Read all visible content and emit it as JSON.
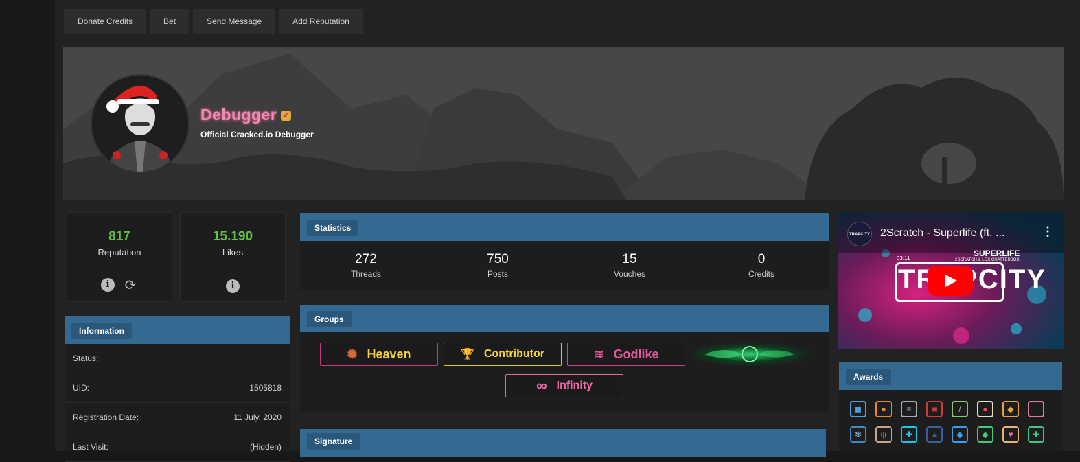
{
  "actions": [
    "Donate Credits",
    "Bet",
    "Send Message",
    "Add Reputation"
  ],
  "profile": {
    "username": "Debugger",
    "usertitle": "Official Cracked.io Debugger",
    "verified_icon": "verified-badge-icon"
  },
  "reputation": {
    "value": "817",
    "label": "Reputation"
  },
  "likes": {
    "value": "15.190",
    "label": "Likes"
  },
  "information": {
    "heading": "Information",
    "rows": [
      {
        "key": "Status:",
        "value": ""
      },
      {
        "key": "UID:",
        "value": "1505818"
      },
      {
        "key": "Registration Date:",
        "value": "11 July, 2020"
      },
      {
        "key": "Last Visit:",
        "value": "(Hidden)"
      }
    ]
  },
  "statistics": {
    "heading": "Statistics",
    "items": [
      {
        "value": "272",
        "label": "Threads"
      },
      {
        "value": "750",
        "label": "Posts"
      },
      {
        "value": "15",
        "label": "Vouches"
      },
      {
        "value": "0",
        "label": "Credits"
      }
    ]
  },
  "groups": {
    "heading": "Groups",
    "badges": [
      "Heaven",
      "Contributor",
      "Godlike",
      "Infinity"
    ]
  },
  "signature": {
    "heading": "Signature"
  },
  "video": {
    "title": "2Scratch - Superlife (ft. ...",
    "channel": "TRAPCITY",
    "overlay_title": "SUPERLIFE",
    "overlay_sub": "2SCRATCH & LOX CHATTERBOX",
    "overlay_time": "03:11",
    "overlay_logo": "TRAPCITY"
  },
  "awards": {
    "heading": "Awards",
    "colors": {
      "accent": "#346a92",
      "green": "#5fc041"
    }
  }
}
